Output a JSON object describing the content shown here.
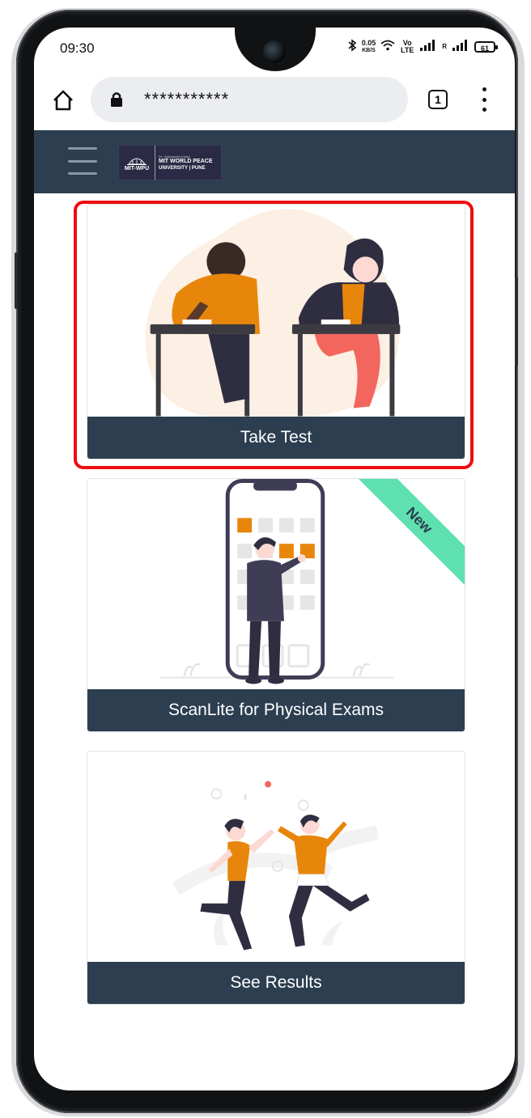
{
  "status_bar": {
    "time": "09:30",
    "net_speed_value": "0.05",
    "net_speed_unit": "KB/S",
    "volte": "Vo LTE",
    "signal_label": "R",
    "battery": "61"
  },
  "browser": {
    "url_masked": "***********",
    "tab_count": "1"
  },
  "navbar": {
    "logo_mark": "MIT-WPU",
    "logo_tagline": "Dr. Vishwanath Karad",
    "logo_name_line1": "MIT WORLD PEACE",
    "logo_name_line2": "UNIVERSITY | PUNE"
  },
  "cards": [
    {
      "label": "Take Test",
      "highlighted": true
    },
    {
      "label": "ScanLite for Physical Exams",
      "badge": "New"
    },
    {
      "label": "See Results"
    }
  ],
  "colors": {
    "navbar": "#2c3e50",
    "highlight": "#ee0d12",
    "accent_orange": "#e8860b",
    "badge": "#5ee0b0"
  }
}
